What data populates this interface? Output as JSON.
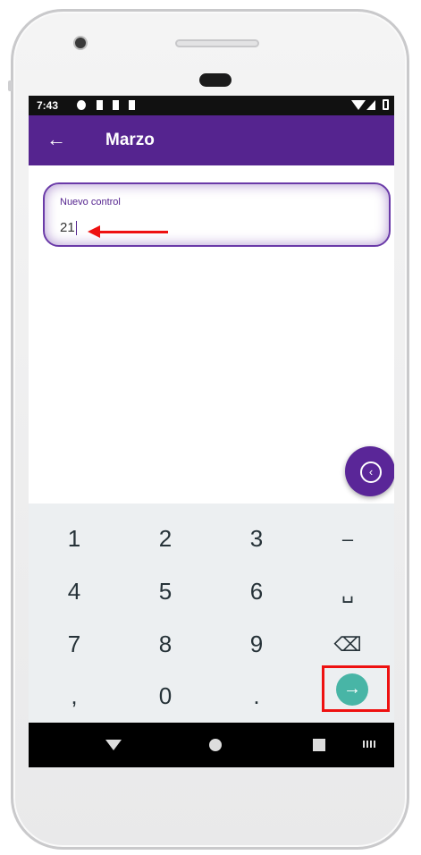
{
  "status_bar": {
    "time": "7:43"
  },
  "app_bar": {
    "title": "Marzo",
    "back_icon": "←"
  },
  "input": {
    "label": "Nuevo control",
    "value": "21"
  },
  "fab": {
    "icon": "‹"
  },
  "keyboard": {
    "rows": [
      [
        "1",
        "2",
        "3",
        "–"
      ],
      [
        "4",
        "5",
        "6",
        "␣"
      ],
      [
        "7",
        "8",
        "9",
        "⌫"
      ],
      [
        ",",
        "0",
        ".",
        "→"
      ]
    ]
  },
  "colors": {
    "primary": "#55248f",
    "go": "#48b5a6",
    "annotation": "#ee1111"
  }
}
